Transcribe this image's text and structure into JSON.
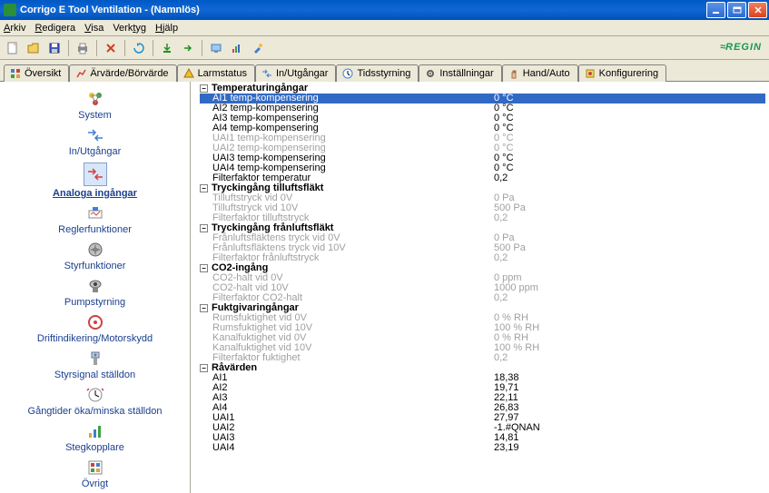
{
  "window": {
    "title": "Corrigo E Tool Ventilation - (Namnlös)"
  },
  "menu": [
    "Arkiv",
    "Redigera",
    "Visa",
    "Verktyg",
    "Hjälp"
  ],
  "brand": "REGIN",
  "tabs": [
    {
      "label": "Översikt"
    },
    {
      "label": "Ärvärde/Börvärde"
    },
    {
      "label": "Larmstatus"
    },
    {
      "label": "In/Utgångar"
    },
    {
      "label": "Tidsstyrning"
    },
    {
      "label": "Inställningar"
    },
    {
      "label": "Hand/Auto"
    },
    {
      "label": "Konfigurering"
    }
  ],
  "nav": [
    {
      "label": "System"
    },
    {
      "label": "In/Utgångar"
    },
    {
      "label": "Analoga ingångar",
      "selected": true
    },
    {
      "label": "Reglerfunktioner"
    },
    {
      "label": "Styrfunktioner"
    },
    {
      "label": "Pumpstyrning"
    },
    {
      "label": "Driftindikering/Motorskydd"
    },
    {
      "label": "Styrsignal ställdon"
    },
    {
      "label": "Gångtider öka/minska ställdon"
    },
    {
      "label": "Stegkopplare"
    },
    {
      "label": "Övrigt"
    }
  ],
  "groups": [
    {
      "title": "Temperaturingångar",
      "rows": [
        {
          "label": "AI1 temp-kompensering",
          "value": "0 °C",
          "selected": true
        },
        {
          "label": "AI2 temp-kompensering",
          "value": "0 °C"
        },
        {
          "label": "AI3 temp-kompensering",
          "value": "0 °C"
        },
        {
          "label": "AI4 temp-kompensering",
          "value": "0 °C"
        },
        {
          "label": "UAI1 temp-kompensering",
          "value": "0 °C",
          "disabled": true
        },
        {
          "label": "UAI2 temp-kompensering",
          "value": "0 °C",
          "disabled": true
        },
        {
          "label": "UAI3 temp-kompensering",
          "value": "0 °C"
        },
        {
          "label": "UAI4 temp-kompensering",
          "value": "0 °C"
        },
        {
          "label": "Filterfaktor temperatur",
          "value": "0,2"
        }
      ]
    },
    {
      "title": "Tryckingång tilluftsfläkt",
      "rows": [
        {
          "label": "Tilluftstryck vid 0V",
          "value": "0 Pa",
          "disabled": true
        },
        {
          "label": "Tilluftstryck vid 10V",
          "value": "500 Pa",
          "disabled": true
        },
        {
          "label": "Filterfaktor tilluftstryck",
          "value": "0,2",
          "disabled": true
        }
      ]
    },
    {
      "title": "Tryckingång frånluftsfläkt",
      "rows": [
        {
          "label": "Frånluftsfläktens tryck vid 0V",
          "value": "0 Pa",
          "disabled": true
        },
        {
          "label": "Frånluftsfläktens tryck vid 10V",
          "value": "500 Pa",
          "disabled": true
        },
        {
          "label": "Filterfaktor frånluftstryck",
          "value": "0,2",
          "disabled": true
        }
      ]
    },
    {
      "title": "CO2-ingång",
      "rows": [
        {
          "label": "CO2-halt vid 0V",
          "value": "0 ppm",
          "disabled": true
        },
        {
          "label": "CO2-halt vid 10V",
          "value": "1000 ppm",
          "disabled": true
        },
        {
          "label": "Filterfaktor CO2-halt",
          "value": "0,2",
          "disabled": true
        }
      ]
    },
    {
      "title": "Fuktgivaringångar",
      "rows": [
        {
          "label": "Rumsfuktighet vid 0V",
          "value": "0 % RH",
          "disabled": true
        },
        {
          "label": "Rumsfuktighet vid 10V",
          "value": "100 % RH",
          "disabled": true
        },
        {
          "label": "Kanalfuktighet vid 0V",
          "value": "0 % RH",
          "disabled": true
        },
        {
          "label": "Kanalfuktighet vid 10V",
          "value": "100 % RH",
          "disabled": true
        },
        {
          "label": "Filterfaktor fuktighet",
          "value": "0,2",
          "disabled": true
        }
      ]
    },
    {
      "title": "Råvärden",
      "rows": [
        {
          "label": "AI1",
          "value": "18,38"
        },
        {
          "label": "AI2",
          "value": "19,71"
        },
        {
          "label": "AI3",
          "value": "22,11"
        },
        {
          "label": "AI4",
          "value": "26,83"
        },
        {
          "label": "UAI1",
          "value": "27,97"
        },
        {
          "label": "UAI2",
          "value": "-1.#QNAN"
        },
        {
          "label": "UAI3",
          "value": "14,81"
        },
        {
          "label": "UAI4",
          "value": "23,19"
        }
      ]
    }
  ]
}
